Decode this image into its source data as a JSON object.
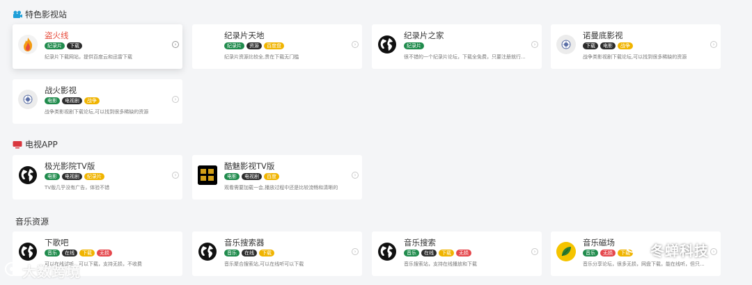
{
  "sections": {
    "featured": {
      "title": "特色影视站"
    },
    "tvapp": {
      "title": "电视APP"
    },
    "music": {
      "title": "音乐资源"
    }
  },
  "cards": [
    {
      "title": "盗火线",
      "tags": [
        "纪录片",
        "下载"
      ],
      "desc": "纪录片下载网站，提供百度云和迅雷下载",
      "logo": "fire-icon"
    },
    {
      "title": "纪录片天地",
      "tags": [
        "纪录片",
        "资源",
        "百度盘"
      ],
      "desc": "纪录片资源比较全,贵在下载无门槛",
      "logo": ""
    },
    {
      "title": "纪录片之家",
      "tags": [
        "纪录片"
      ],
      "desc": "很不错的一个纪录片论坛，下载全免费，只要注册就行...",
      "logo": "globe-icon"
    },
    {
      "title": "诺曼底影视",
      "tags": [
        "下载",
        "电影",
        "战争"
      ],
      "desc": "战争类影视剧下载论坛,可以找到很多稀缺的资源",
      "logo": "seal-icon"
    },
    {
      "title": "战火影视",
      "tags": [
        "电影",
        "电视剧",
        "战争"
      ],
      "desc": "战争类影视剧下载论坛,可以找到很多稀缺的资源",
      "logo": "seal-icon"
    },
    {
      "title": "极光影院TV版",
      "tags": [
        "电影",
        "电视剧",
        "纪录片"
      ],
      "desc": "TV版几乎没有广告，体验不错",
      "logo": "globe-icon"
    },
    {
      "title": "酷魅影视TV版",
      "tags": [
        "电影",
        "电视剧",
        "百度"
      ],
      "desc": "观看需要加载一会,播放过程中还是比较流畅和清晰的",
      "logo": "kumei-logo-icon"
    },
    {
      "title": "下歌吧",
      "tags": [
        "音乐",
        "在线",
        "下载",
        "无损"
      ],
      "desc": "可以在线试听，可以下载，支持无损，不收费",
      "logo": "globe-icon"
    },
    {
      "title": "音乐搜索器",
      "tags": [
        "音乐",
        "在线",
        "下载"
      ],
      "desc": "音乐聚合搜索站,可以在线听可以下载",
      "logo": "globe-icon"
    },
    {
      "title": "音乐搜索",
      "tags": [
        "音乐",
        "在线",
        "下载",
        "无损"
      ],
      "desc": "音乐搜索站，支持在线播放和下载",
      "logo": "globe-icon"
    },
    {
      "title": "音乐磁场",
      "tags": [
        "音乐",
        "无损",
        "下载"
      ],
      "desc": "音乐分享论坛，很多无损，网盘下载，能在线听，但只...",
      "logo": "leaf-icon"
    }
  ],
  "tag_colors": {
    "纪录片": "#1f8b4c",
    "下载": "#2c2c2c",
    "资源": "#2c2c2c",
    "百度盘": "#f0b400",
    "电影": "#1f8b4c",
    "电视剧": "#2c2c2c",
    "战争": "#f0b400",
    "百度": "#f0b400",
    "音乐": "#1f8b4c",
    "在线": "#2c2c2c",
    "无损": "#e5484d"
  },
  "watermarks": {
    "left": "大数跨境",
    "right": "冬蝉科技"
  }
}
